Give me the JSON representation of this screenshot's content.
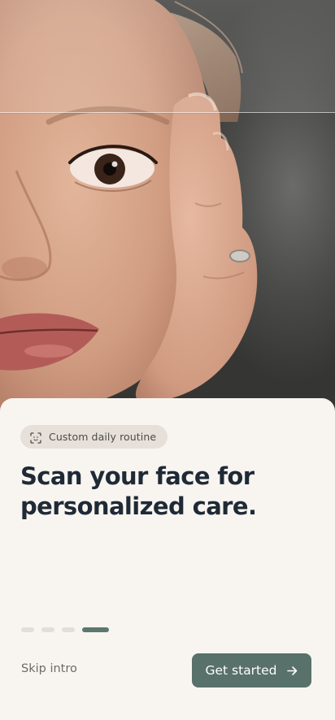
{
  "photo": {
    "icon": "hero-photo-face"
  },
  "chip": {
    "icon": "face-scan-icon",
    "label": "Custom daily routine"
  },
  "headline": {
    "line1": "Scan your face for",
    "line2": "personalized care."
  },
  "pager": {
    "total": 4,
    "active_index": 3
  },
  "actions": {
    "skip_label": "Skip intro",
    "primary_label": "Get started",
    "primary_icon": "arrow-right-icon"
  },
  "colors": {
    "sheet_background": "#f8f5f1",
    "chip_background": "#e6e0d9",
    "headline_text": "#1f2a36",
    "accent": "#58716a",
    "pager_inactive": "#e4ded7"
  }
}
